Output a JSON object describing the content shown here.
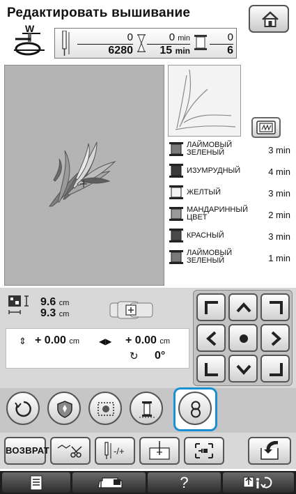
{
  "header": {
    "title": "Редактировать вышивание",
    "presser_foot_label": "W"
  },
  "status": {
    "stitch_current": "0",
    "stitch_total": "6280",
    "time_current": "0",
    "time_current_unit": "min",
    "time_total": "15",
    "time_total_unit": "min",
    "color_current": "0",
    "color_total": "6"
  },
  "thread_colors": [
    {
      "name": "ЛАЙМОВЫЙ ЗЕЛЕНЫЙ",
      "time": "3 min",
      "swatch": "#7a7a7a"
    },
    {
      "name": "ИЗУМРУДНЫЙ",
      "time": "4 min",
      "swatch": "#3a3a3a"
    },
    {
      "name": "ЖЕЛТЫЙ",
      "time": "3 min",
      "swatch": "#f2f2f2"
    },
    {
      "name": "МАНДАРИННЫЙ ЦВЕТ",
      "time": "2 min",
      "swatch": "#9a9a9a"
    },
    {
      "name": "КРАСНЫЙ",
      "time": "3 min",
      "swatch": "#4a4a4a"
    },
    {
      "name": "ЛАЙМОВЫЙ ЗЕЛЕНЫЙ",
      "time": "1 min",
      "swatch": "#7a7a7a"
    }
  ],
  "size": {
    "width_value": "9.6",
    "width_unit": "cm",
    "height_value": "9.3",
    "height_unit": "cm"
  },
  "offset": {
    "vertical_value": "+ 0.00",
    "vertical_unit": "cm",
    "horizontal_value": "+ 0.00",
    "horizontal_unit": "cm",
    "rotation": "0°"
  },
  "buttons": {
    "return_label": "ВОЗВРАТ",
    "help_label": "?"
  },
  "colors": {
    "highlight": "#1a8fd2",
    "preview_bg": "#b4b4b4"
  }
}
